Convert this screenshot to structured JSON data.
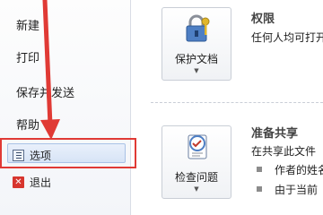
{
  "nav": {
    "items": [
      {
        "label": "新建"
      },
      {
        "label": "打印"
      },
      {
        "label": "保存并发送"
      },
      {
        "label": "帮助"
      }
    ],
    "options_label": "选项",
    "exit_label": "退出"
  },
  "permissions": {
    "button_label": "保护文档",
    "title": "权限",
    "text": "任何人均可打开"
  },
  "prepare": {
    "button_label": "检查问题",
    "title": "准备共享",
    "text": "在共享此文件",
    "bullets": [
      "作者的姓名",
      "由于当前"
    ]
  },
  "colors": {
    "annotation": "#e03a35",
    "selection": "#d7e4f6"
  },
  "icons": {
    "options": "options-icon",
    "exit": "exit-icon",
    "protect": "lock-key-icon",
    "inspect": "checklist-icon"
  }
}
